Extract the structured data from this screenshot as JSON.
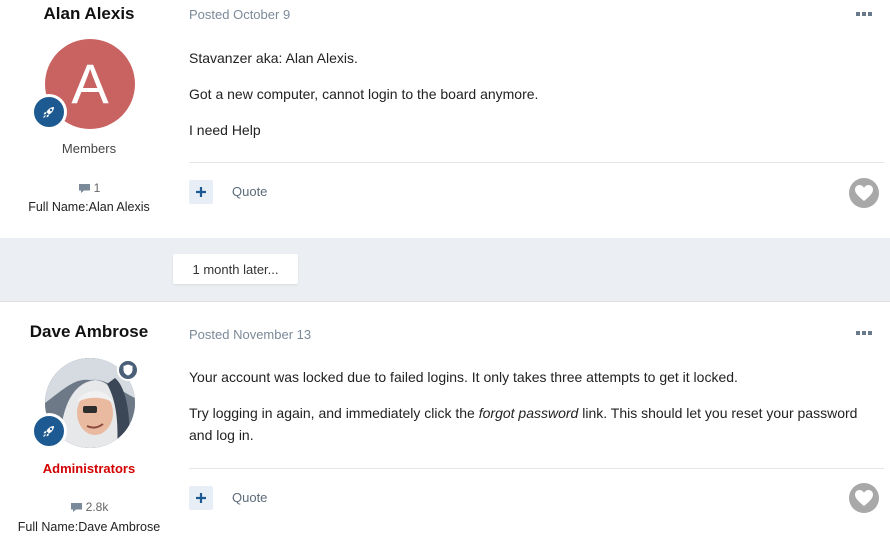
{
  "posts": [
    {
      "author": "Alan Alexis",
      "avatar_letter": "A",
      "group": "Members",
      "post_count": "1",
      "full_name": "Full Name:Alan Alexis",
      "date": "Posted October 9",
      "paragraphs": [
        "Stavanzer aka: Alan Alexis.",
        "Got a new computer, cannot login to the board anymore.",
        "I need Help"
      ],
      "quote_label": "Quote"
    },
    {
      "author": "Dave Ambrose",
      "group": "Administrators",
      "post_count": "2.8k",
      "full_name": "Full Name:Dave Ambrose",
      "date": "Posted November 13",
      "paragraph1": "Your account was locked due to failed logins. It only takes three attempts to get it locked.",
      "paragraph2_before": "Try logging in again, and immediately click the ",
      "paragraph2_em": "forgot password",
      "paragraph2_after": " link. This should let you reset your password and log in.",
      "quote_label": "Quote"
    }
  ],
  "separator": "1 month later...",
  "colors": {
    "avatar_bg": "#c86362",
    "rank_badge": "#1d5a91",
    "admin_group": "#d30000",
    "like_button": "#a8a8a8"
  }
}
